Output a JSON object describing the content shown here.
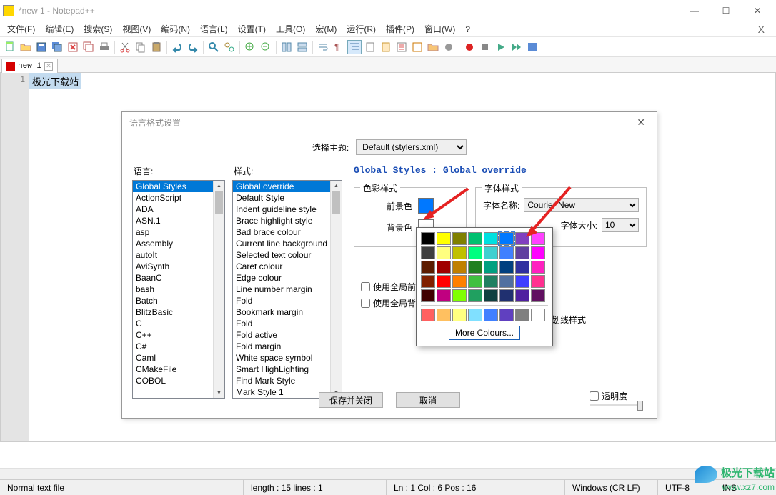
{
  "window": {
    "title": "*new 1 - Notepad++"
  },
  "menus": [
    "文件(F)",
    "编辑(E)",
    "搜索(S)",
    "视图(V)",
    "编码(N)",
    "语言(L)",
    "设置(T)",
    "工具(O)",
    "宏(M)",
    "运行(R)",
    "插件(P)",
    "窗口(W)",
    "?"
  ],
  "tab": {
    "label": "new 1"
  },
  "editor": {
    "line1_number": "1",
    "line1_text": "极光下载站"
  },
  "dialog": {
    "title": "语言格式设置",
    "theme_label": "选择主题:",
    "theme_value": "Default (stylers.xml)",
    "lang_label": "语言:",
    "style_label": "样式:",
    "langs": [
      "Global Styles",
      "ActionScript",
      "ADA",
      "ASN.1",
      "asp",
      "Assembly",
      "autoIt",
      "AviSynth",
      "BaanC",
      "bash",
      "Batch",
      "BlitzBasic",
      "C",
      "C++",
      "C#",
      "Caml",
      "CMakeFile",
      "COBOL"
    ],
    "styles": [
      "Global override",
      "Default Style",
      "Indent guideline style",
      "Brace highlight style",
      "Bad brace colour",
      "Current line background",
      "Selected text colour",
      "Caret colour",
      "Edge colour",
      "Line number margin",
      "Fold",
      "Bookmark margin",
      "Fold",
      "Fold active",
      "Fold margin",
      "White space symbol",
      "Smart HighLighting",
      "Find Mark Style",
      "Mark Style 1"
    ],
    "rp_title": "Global Styles : Global override",
    "color_legend": "色彩样式",
    "fg_label": "前景色",
    "bg_label": "背景色",
    "fg_color": "#0078ff",
    "font_legend": "字体样式",
    "font_name_label": "字体名称:",
    "font_name_value": "Courier New",
    "font_size_label": "字体大小:",
    "font_size_value": "10",
    "use_global_fg": "使用全局前景色",
    "use_global_bg": "使用全局背景色",
    "use_global_strike": "使用全局下划线样式",
    "save_close": "保存并关闭",
    "cancel": "取消",
    "transparency": "透明度"
  },
  "picker": {
    "rows": [
      [
        "#000000",
        "#ffff00",
        "#808000",
        "#00c070",
        "#00e0e0",
        "#0078ff",
        "#8040c0",
        "#ff40ff"
      ],
      [
        "#404040",
        "#ffff80",
        "#c0c000",
        "#00ff80",
        "#40d0d0",
        "#4080ff",
        "#6040a0",
        "#ff00ff"
      ],
      [
        "#5c1c00",
        "#a00000",
        "#c08000",
        "#208020",
        "#00a080",
        "#004080",
        "#3030a0",
        "#ff20c0"
      ],
      [
        "#802000",
        "#ff0000",
        "#ff8000",
        "#40c040",
        "#208060",
        "#5070a0",
        "#4040ff",
        "#ff3090"
      ],
      [
        "#400000",
        "#c00080",
        "#80ff00",
        "#20a060",
        "#104040",
        "#203070",
        "#5020a0",
        "#601060"
      ]
    ],
    "row2": [
      "#ff6060",
      "#ffc060",
      "#ffff80",
      "#80e0ff",
      "#4080ff",
      "#6040c0",
      "#808080",
      "#ffffff"
    ],
    "current": [
      0,
      5
    ],
    "more": "More Colours..."
  },
  "status": {
    "file_type": "Normal text file",
    "len_lines": "length : 15    lines : 1",
    "pos": "Ln : 1    Col : 6    Pos : 16",
    "eol": "Windows (CR LF)",
    "enc": "UTF-8",
    "ins": "INS"
  },
  "watermark": {
    "brand": "极光下载站",
    "site": "www.xz7.com"
  }
}
